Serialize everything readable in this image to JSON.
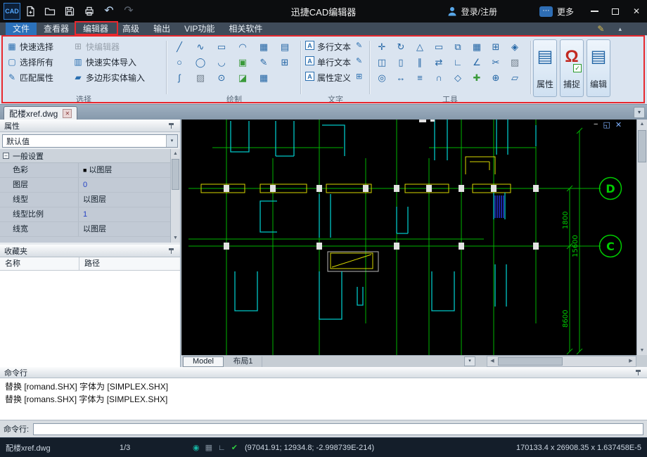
{
  "colors": {
    "accent": "#2b71ba",
    "annotation": "#e8282e",
    "canvas_green": "#00c000",
    "canvas_cyan": "#00c6c6",
    "canvas_yellow": "#d8d800",
    "canvas_hatch_blue": "#2435d6"
  },
  "icons": {
    "undo": "↶",
    "redo": "↷",
    "pencil": "✎",
    "collapse": "▴",
    "dropdown": "▾",
    "close": "✕",
    "more": "⋯",
    "minus": "−",
    "swatch": "■",
    "letter_a": "A",
    "check": "✓",
    "up": "▲",
    "down": "▼",
    "left": "◀",
    "right": "▶",
    "viewport_min": "−",
    "viewport_restore": "◱",
    "viewport_close": "✕",
    "status_snap": "◉",
    "status_grid": "▦",
    "status_ortho": "∟",
    "status_ok": "✔"
  },
  "title_bar": {
    "logo": "CAD",
    "title": "迅捷CAD编辑器",
    "login": "登录/注册",
    "more": "更多"
  },
  "menu": {
    "tabs": [
      "文件",
      "查看器",
      "编辑器",
      "高级",
      "输出",
      "VIP功能",
      "相关软件"
    ]
  },
  "ribbon": {
    "selection": {
      "label": "选择",
      "items": [
        {
          "icon": "▦",
          "label": "快速选择"
        },
        {
          "icon": "⊞",
          "label": "快编辑器"
        },
        {
          "icon": "▢",
          "label": "选择所有"
        },
        {
          "icon": "▥",
          "label": "快速实体导入"
        },
        {
          "icon": "✎",
          "label": "匹配属性"
        },
        {
          "icon": "▰",
          "label": "多边形实体输入"
        }
      ]
    },
    "draw": {
      "label": "绘制",
      "rows": [
        [
          "╱",
          "∿",
          "▭",
          "◠",
          "▦",
          "▤"
        ],
        [
          "○",
          "◯",
          "◡",
          "▣",
          "✎",
          "⊞"
        ],
        [
          "ʃ",
          "▨",
          "⊙",
          "◪",
          "▦",
          ""
        ]
      ]
    },
    "text": {
      "label": "文字",
      "items": [
        "多行文本",
        "单行文本",
        "属性定义"
      ],
      "side_icons": [
        "✎",
        "✎",
        "⊞"
      ]
    },
    "tools": {
      "label": "工具",
      "rows": [
        [
          "✛",
          "↻",
          "△",
          "▭",
          "⧉",
          "▦",
          "⊞",
          "◈"
        ],
        [
          "◫",
          "▯",
          "∥",
          "⇄",
          "∟",
          "∠",
          "✂",
          "▨"
        ],
        [
          "◎",
          "↔",
          "≡",
          "∩",
          "◇",
          "✚",
          "⊕",
          "▱"
        ]
      ]
    },
    "big_buttons": [
      {
        "icon": "▤",
        "label": "属性"
      },
      {
        "icon": "Ω",
        "label": "捕捉"
      },
      {
        "icon": "▤",
        "label": "编辑"
      }
    ]
  },
  "doc_tab": {
    "title": "配楼xref.dwg"
  },
  "properties": {
    "title": "属性",
    "preset": "默认值",
    "group": "一般设置",
    "rows": [
      {
        "label": "色彩",
        "value": "以图层"
      },
      {
        "label": "图层",
        "value": "0"
      },
      {
        "label": "线型",
        "value": "以图层"
      },
      {
        "label": "线型比例",
        "value": "1"
      },
      {
        "label": "线宽",
        "value": "以图层"
      }
    ]
  },
  "favorites": {
    "title": "收藏夹",
    "columns": [
      "名称",
      "路径"
    ]
  },
  "canvas": {
    "axis_d": "D",
    "axis_c": "C",
    "dim_1800": "1800",
    "dim_15600": "15600",
    "dim_8600": "8600",
    "model_tab": "Model",
    "layout_tab": "布局1"
  },
  "command": {
    "title": "命令行",
    "history": [
      "替换 [romand.SHX] 字体为 [SIMPLEX.SHX]",
      "替换 [romans.SHX] 字体为 [SIMPLEX.SHX]"
    ],
    "prompt": "命令行:"
  },
  "status_bar": {
    "file": "配楼xref.dwg",
    "page": "1/3",
    "coords": "(97041.91; 12934.8; -2.998739E-214)",
    "extents": "170133.4 x 26908.35 x 1.637458E-5"
  }
}
